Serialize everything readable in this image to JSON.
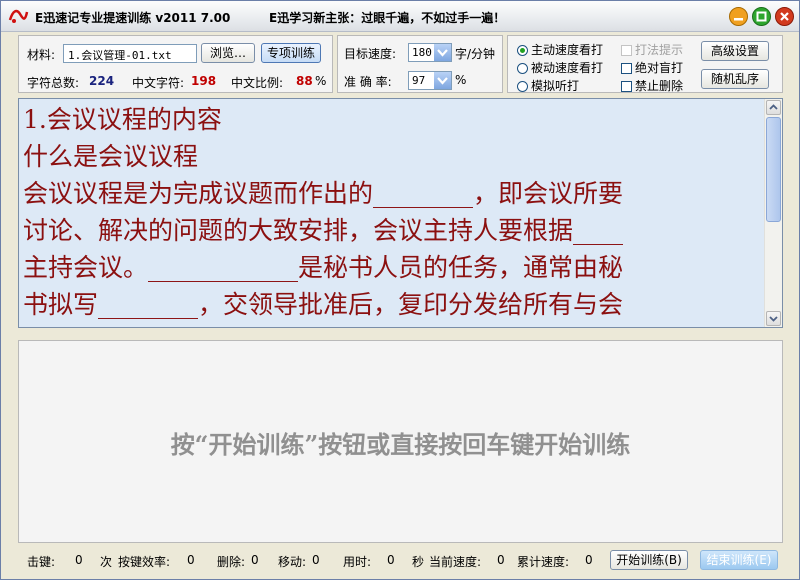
{
  "window": {
    "title": "E迅速记专业提速训练 v2011  7.00",
    "slogan": "E迅学习新主张：过眼千遍，不如过手一遍！"
  },
  "material": {
    "label": "材料:",
    "file": "1.会议管理-01.txt",
    "browse_label": "浏览…",
    "special_label": "专项训练",
    "total_chars_label": "字符总数:",
    "total_chars": "224",
    "cn_chars_label": "中文字符:",
    "cn_chars": "198",
    "cn_ratio_label": "中文比例:",
    "cn_ratio": "88",
    "percent": "%"
  },
  "targets": {
    "speed_label": "目标速度:",
    "speed_value": "180",
    "speed_unit": "字/分钟",
    "accuracy_label": "准 确 率:",
    "accuracy_value": "97",
    "accuracy_unit": "%"
  },
  "mode": {
    "options": [
      "主动速度看打",
      "被动速度看打",
      "模拟听打"
    ],
    "selected": 0
  },
  "checks": {
    "hint_label": "打法提示",
    "blind_label": "绝对盲打",
    "no_delete_label": "禁止删除"
  },
  "buttons": {
    "advanced_label": "高级设置",
    "shuffle_label": "随机乱序"
  },
  "text": {
    "lines": [
      "1.会议议程的内容",
      "什么是会议议程",
      "会议议程是为完成议题而作出的________，即会议所要",
      "讨论、解决的问题的大致安排，会议主持人要根据____",
      "主持会议。____________是秘书人员的任务，通常由秘",
      "书拟写________，交领导批准后，复印分发给所有与会"
    ]
  },
  "input_prompt": "按“开始训练”按钮或直接按回车键开始训练",
  "status": {
    "keystrokes_label": "击键:",
    "keystrokes_value": "0",
    "keystrokes_unit": "次",
    "efficiency_label": "按键效率:",
    "efficiency_value": "0",
    "delete_label": "删除:",
    "delete_value": "0",
    "move_label": "移动:",
    "move_value": "0",
    "time_label": "用时:",
    "time_value": "0",
    "time_unit": "秒",
    "current_speed_label": "当前速度:",
    "current_speed_value": "0",
    "total_speed_label": "累计速度:",
    "total_speed_value": "0",
    "start_label": "开始训练(B)",
    "end_label": "结束训练(E)"
  },
  "colors": {
    "text_color": "#8b1010",
    "reading_bg": "#dde9f6",
    "minimize": "#f0a020",
    "maximize": "#2da52d",
    "close": "#d23a1e"
  },
  "icons": {
    "app": "logo-icon",
    "minimize": "minimize-icon",
    "maximize": "maximize-icon",
    "close": "close-icon"
  }
}
